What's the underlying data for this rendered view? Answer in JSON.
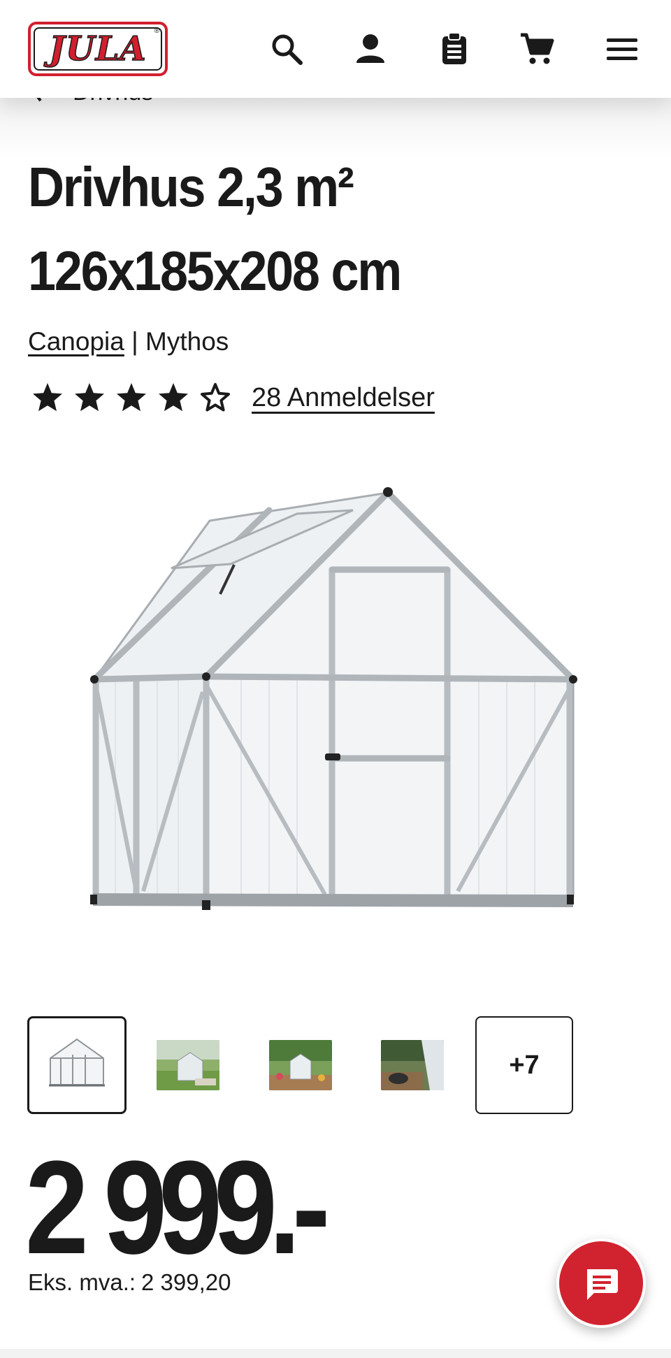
{
  "header": {
    "logo_text": "JULA",
    "logo_reg": "®",
    "icons": [
      "search-icon",
      "account-icon",
      "shopping-list-icon",
      "cart-icon",
      "menu-icon"
    ]
  },
  "breadcrumb": {
    "back_label": "Drivhus"
  },
  "product": {
    "title_line1": "Drivhus 2,3 m²",
    "title_line2": "126x185x208 cm",
    "brand": "Canopia",
    "separator": "|",
    "model": "Mythos",
    "rating": 4,
    "rating_max": 5,
    "reviews_label": "28 Anmeldelser"
  },
  "gallery": {
    "more_label": "+7",
    "thumbnail_count_visible": 4
  },
  "price": {
    "amount": "2 999.-",
    "vat_label": "Eks. mva.:",
    "vat_value": "2 399,20"
  },
  "colors": {
    "brand_red": "#d21f2e",
    "text": "#1a1a1a",
    "chat_button": "#d1232f"
  }
}
